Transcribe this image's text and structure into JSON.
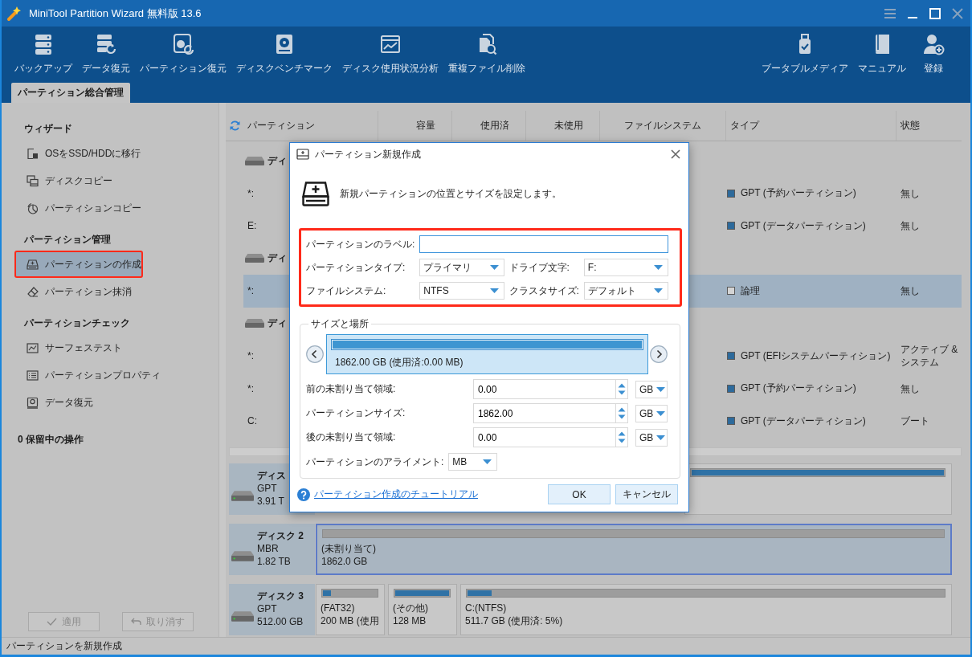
{
  "window": {
    "title": "MiniTool Partition Wizard 無料版 13.6"
  },
  "toolbar": {
    "left": [
      {
        "label": "バックアップ"
      },
      {
        "label": "データ復元"
      },
      {
        "label": "パーティション復元"
      },
      {
        "label": "ディスクベンチマーク"
      },
      {
        "label": "ディスク使用状況分析"
      },
      {
        "label": "重複ファイル削除"
      }
    ],
    "right": [
      {
        "label": "ブータブルメディア"
      },
      {
        "label": "マニュアル"
      },
      {
        "label": "登録"
      }
    ]
  },
  "tabs": [
    {
      "label": "パーティション総合管理",
      "selected": true
    }
  ],
  "sidebar": {
    "sections": [
      {
        "title": "ウィザード",
        "items": [
          {
            "label": "OSをSSD/HDDに移行",
            "selected": false,
            "marked": false
          },
          {
            "label": "ディスクコピー",
            "selected": false,
            "marked": false
          },
          {
            "label": "パーティションコピー",
            "selected": false,
            "marked": false
          }
        ]
      },
      {
        "title": "パーティション管理",
        "items": [
          {
            "label": "パーティションの作成",
            "selected": true,
            "marked": true
          },
          {
            "label": "パーティション抹消",
            "selected": false,
            "marked": false
          }
        ]
      },
      {
        "title": "パーティションチェック",
        "items": [
          {
            "label": "サーフェステスト",
            "selected": false,
            "marked": false
          },
          {
            "label": "パーティションプロパティ",
            "selected": false,
            "marked": false
          },
          {
            "label": "データ復元",
            "selected": false,
            "marked": false
          }
        ]
      }
    ],
    "pending": "0 保留中の操作",
    "buttons": [
      {
        "label": "適用",
        "disabled": true
      },
      {
        "label": "取り消す",
        "disabled": true
      }
    ]
  },
  "table": {
    "columns": [
      "パーティション",
      "容量",
      "使用済",
      "未使用",
      "ファイルシステム",
      "タイプ",
      "状態"
    ],
    "rows": [
      {
        "kind": "disk",
        "label": "ディ"
      },
      {
        "kind": "partition",
        "partition": "*:",
        "type": "GPT (予約パーティション)",
        "color": "#2d6a9b",
        "status": "無し",
        "selected": false
      },
      {
        "kind": "partition",
        "partition": "E:",
        "type": "GPT (データパーティション)",
        "color": "#2d6a9b",
        "status": "無し",
        "selected": false
      },
      {
        "kind": "disk",
        "label": "ディ"
      },
      {
        "kind": "partition",
        "partition": "*:",
        "type": "論理",
        "color": "#d4d4d4",
        "status": "無し",
        "selected": true
      },
      {
        "kind": "disk",
        "label": "ディ"
      },
      {
        "kind": "partition",
        "partition": "*:",
        "type": "GPT (EFIシステムパーティション)",
        "color": "#2d6a9b",
        "status": "アクティブ & システム",
        "selected": false
      },
      {
        "kind": "partition",
        "partition": "*:",
        "type": "GPT (予約パーティション)",
        "color": "#2d6a9b",
        "status": "無し",
        "selected": false
      },
      {
        "kind": "partition",
        "partition": "C:",
        "type": "GPT (データパーティション)",
        "color": "#2d6a9b",
        "status": "ブート",
        "selected": false
      }
    ]
  },
  "disk_map": [
    {
      "name": "ディス",
      "style": "GPT",
      "size": "3.91 T",
      "partitions": [
        {
          "level": 1,
          "selected": false
        }
      ]
    },
    {
      "name": "ディスク 2",
      "style": "MBR",
      "size": "1.82 TB",
      "partitions": [
        {
          "name": "(未割り当て)",
          "size": "1862.0 GB",
          "selected": true
        }
      ]
    },
    {
      "name": "ディスク 3",
      "style": "GPT",
      "size": "512.00 GB",
      "partitions": [
        {
          "name": "(FAT32)",
          "size": "200 MB (使用",
          "level": 0.15,
          "selected": false
        },
        {
          "name": "(その他)",
          "size": "128 MB",
          "level": 1,
          "selected": false
        },
        {
          "name": "C:(NTFS)",
          "size": "511.7 GB (使用済: 5%)",
          "level": 0.05,
          "selected": false
        }
      ]
    }
  ],
  "status_bar": {
    "text": "パーティションを新規作成"
  },
  "dialog": {
    "title": "パーティション新規作成",
    "intro": "新規パーティションの位置とサイズを設定します。",
    "marked": true,
    "label_field": {
      "label": "パーティションのラベル:",
      "focused": true
    },
    "selects": [
      {
        "label": "パーティションタイプ:",
        "value": "プライマリ"
      },
      {
        "label": "ドライブ文字:",
        "value": "F:"
      },
      {
        "label": "ファイルシステム:",
        "value": "NTFS"
      },
      {
        "label": "クラスタサイズ:",
        "value": "デフォルト"
      }
    ],
    "size_location": {
      "legend": "サイズと場所",
      "bar": {
        "text": "1862.00 GB (使用済:0.00 MB)",
        "level": 1
      },
      "rows": [
        {
          "label": "前の未割り当て領域:",
          "value": "0.00",
          "unit": "GB"
        },
        {
          "label": "パーティションサイズ:",
          "value": "1862.00",
          "unit": "GB"
        },
        {
          "label": "後の未割り当て領域:",
          "value": "0.00",
          "unit": "GB"
        }
      ],
      "alignment": {
        "label": "パーティションのアライメント:",
        "value": "MB"
      }
    },
    "help_link": "パーティション作成のチュートリアル",
    "buttons": [
      {
        "label": "OK"
      },
      {
        "label": "キャンセル"
      }
    ]
  }
}
